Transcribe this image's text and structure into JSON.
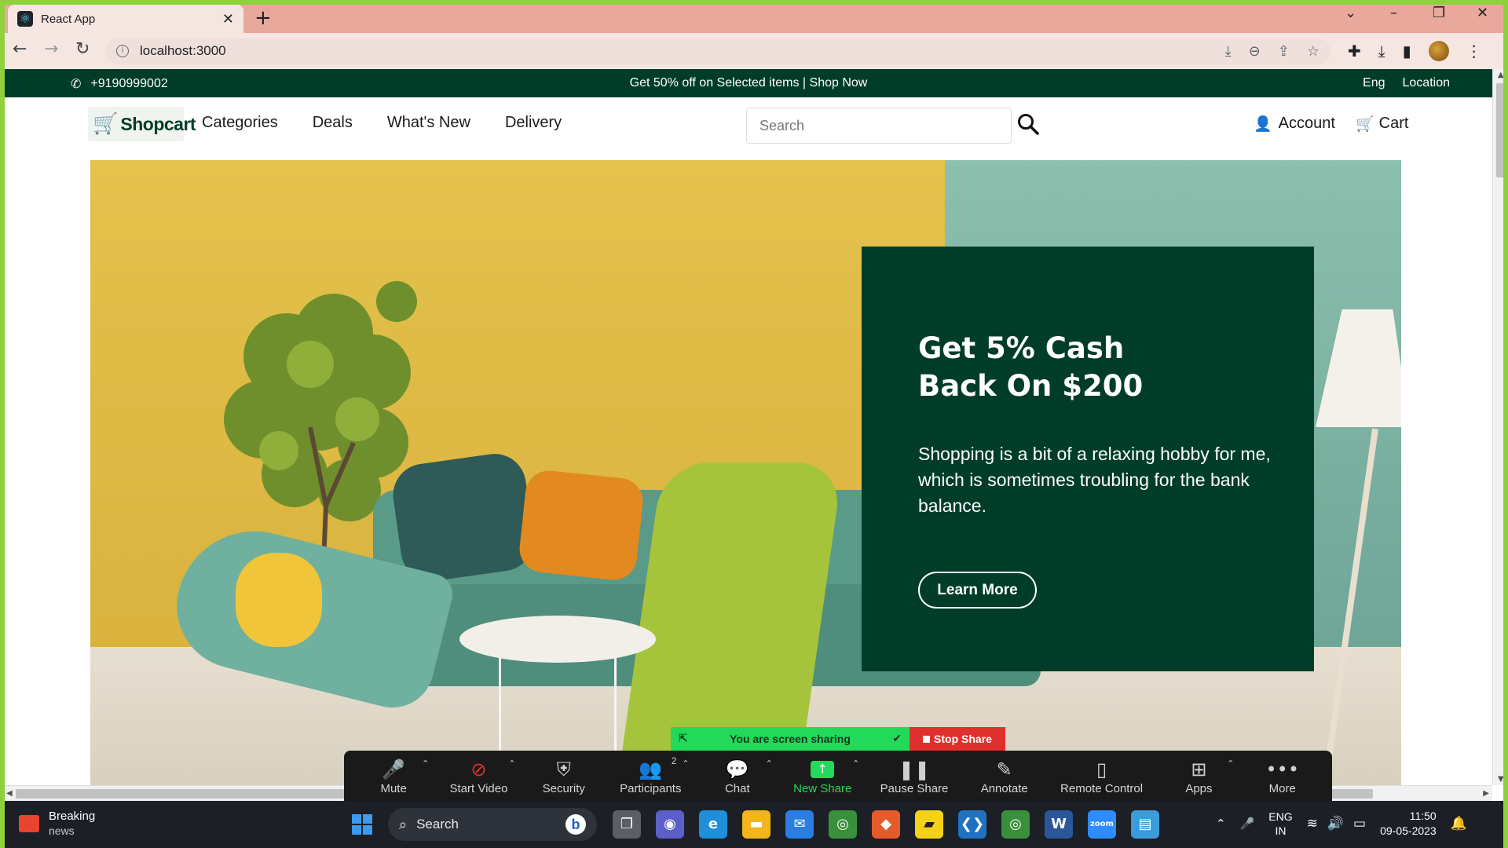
{
  "browser": {
    "tab_title": "React App",
    "tab_icon": "react-icon",
    "url": "localhost:3000"
  },
  "topbar": {
    "phone": "+9190999002",
    "promo_text": "Get 50% off on Selected items | Shop Now",
    "lang": "Eng",
    "location": "Location"
  },
  "nav": {
    "logo": "Shopcart",
    "links": [
      "Categories",
      "Deals",
      "What's New",
      "Delivery"
    ],
    "search_placeholder": "Search",
    "account": "Account",
    "cart": "Cart"
  },
  "hero": {
    "title_line1": "Get 5% Cash",
    "title_line2": "Back On $200",
    "text": "Shopping is a bit of a relaxing hobby for me, which is sometimes troubling for the bank balance.",
    "button": "Learn More",
    "box_color": "#003d29"
  },
  "zoom": {
    "banner_text": "You are screen sharing",
    "stop_label": "Stop Share",
    "items": [
      {
        "label": "Mute",
        "icon": "microphone-icon"
      },
      {
        "label": "Start Video",
        "icon": "video-off-icon"
      },
      {
        "label": "Security",
        "icon": "shield-icon"
      },
      {
        "label": "Participants",
        "icon": "participants-icon",
        "count": "2"
      },
      {
        "label": "Chat",
        "icon": "chat-icon"
      },
      {
        "label": "New Share",
        "icon": "share-up-icon"
      },
      {
        "label": "Pause Share",
        "icon": "pause-icon"
      },
      {
        "label": "Annotate",
        "icon": "pencil-icon"
      },
      {
        "label": "Remote Control",
        "icon": "mouse-icon"
      },
      {
        "label": "Apps",
        "icon": "apps-icon"
      },
      {
        "label": "More",
        "icon": "more-icon"
      }
    ]
  },
  "taskbar": {
    "news_title": "Breaking",
    "news_sub": "news",
    "search": "Search",
    "lang_line1": "ENG",
    "lang_line2": "IN",
    "time": "11:50",
    "date": "09-05-2023"
  }
}
